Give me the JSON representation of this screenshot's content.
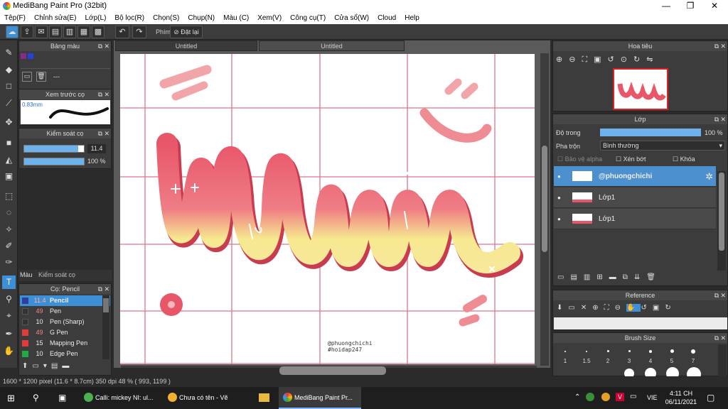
{
  "app": {
    "title": "MediBang Paint Pro (32bit)"
  },
  "window_controls": {
    "minimize": "—",
    "maximize": "❐",
    "close": "✕"
  },
  "menu": [
    "Tệp(F)",
    "Chỉnh sửa(E)",
    "Lớp(L)",
    "Bộ lọc(R)",
    "Chọn(S)",
    "Chụp(N)",
    "Màu (C)",
    "Xem(V)",
    "Công cụ(T)",
    "Cửa sổ(W)",
    "Cloud",
    "Help"
  ],
  "toolbar": {
    "keys_label": "Phím",
    "reset_label": "Đặt lại"
  },
  "panels": {
    "color_palette": {
      "title": "Bảng màu",
      "empty_text": "---"
    },
    "brush_preview": {
      "title": "Xem trước cọ",
      "size": "0.83mm"
    },
    "brush_control": {
      "title": "Kiểm soát cọ",
      "size_value": "11.4",
      "size_fill": 0.9,
      "opacity_value": "100 %",
      "opacity_fill": 1.0
    },
    "tabs": [
      "Màu",
      "Kiểm soát cọ"
    ],
    "brush_list": {
      "title": "Cọ: Pencil",
      "items": [
        {
          "size": "11.4",
          "name": "Pencil",
          "color": "#2f3e9e",
          "selected": true
        },
        {
          "size": "49",
          "name": "Pen",
          "color": "#333333"
        },
        {
          "size": "10",
          "name": "Pen (Sharp)",
          "color": "#333333"
        },
        {
          "size": "49",
          "name": "G Pen",
          "color": "#e33b3b"
        },
        {
          "size": "15",
          "name": "Mapping Pen",
          "color": "#e33b3b"
        },
        {
          "size": "10",
          "name": "Edge Pen",
          "color": "#22aa44"
        }
      ]
    },
    "navigator": {
      "title": "Hoa tiêu"
    },
    "layers": {
      "title": "Lớp",
      "opacity_label": "Độ trong",
      "opacity_value": "100 %",
      "opacity_fill": 1.0,
      "blend_label": "Pha trộn",
      "blend_value": "Bình thường",
      "protect_alpha": "Bảo vệ alpha",
      "clipping": "Xén bớt",
      "lock": "Khóa",
      "items": [
        {
          "name": "@phuongchichi",
          "selected": true
        },
        {
          "name": "Lớp1",
          "selected": false
        },
        {
          "name": "Lớp1",
          "selected": false
        }
      ]
    },
    "reference": {
      "title": "Reference"
    },
    "brush_size": {
      "title": "Brush Size",
      "sizes": [
        "1",
        "1.5",
        "2",
        "3",
        "4",
        "5",
        "7"
      ]
    }
  },
  "canvas": {
    "tabs": [
      "Untitled",
      "Untitled"
    ],
    "watermark_line1": "@phuongchichi",
    "watermark_line2": "#hoidap247"
  },
  "status": {
    "info": "1600 * 1200 pixel   (11.6 * 8.7cm)   350 dpi   48 %   ( 993, 1199 )"
  },
  "taskbar": {
    "apps": [
      "Calli: mickey NI: ul...",
      "Chưa có tên - Vẽ",
      "",
      "MediBang Paint Pr..."
    ],
    "language": "VIE",
    "time": "4:11 CH",
    "date": "06/11/2021"
  },
  "colors": {
    "accent": "#3d8fd6",
    "grid": "#d9778a",
    "letter_top": "#e8566a",
    "letter_bottom": "#f6e98f"
  }
}
